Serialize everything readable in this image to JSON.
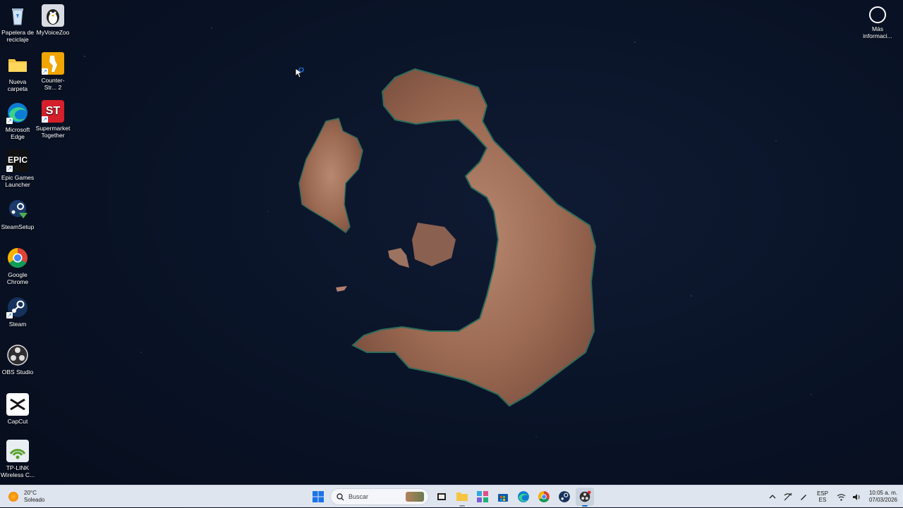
{
  "desktop": {
    "icons": [
      {
        "label": "Papelera de reciclaje",
        "icon": "recycle-bin-icon"
      },
      {
        "label": "MyVoiceZoo",
        "icon": "penguin-app-icon"
      },
      {
        "label": "Nueva carpeta",
        "icon": "folder-icon"
      },
      {
        "label": "Counter-Str... 2",
        "icon": "counter-strike-icon"
      },
      {
        "label": "Microsoft Edge",
        "icon": "edge-icon"
      },
      {
        "label": "Supermarket Together",
        "icon": "supermarket-together-icon"
      },
      {
        "label": "Epic Games Launcher",
        "icon": "epic-games-icon"
      },
      {
        "label": "SteamSetup",
        "icon": "steam-setup-icon"
      },
      {
        "label": "Google Chrome",
        "icon": "chrome-icon"
      },
      {
        "label": "Steam",
        "icon": "steam-icon"
      },
      {
        "label": "OBS Studio",
        "icon": "obs-icon"
      },
      {
        "label": "CapCut",
        "icon": "capcut-icon"
      },
      {
        "label": "TP-LINK Wireless C...",
        "icon": "tplink-wireless-icon"
      }
    ],
    "info_widget_label": "Más informaci...",
    "epic_logo_text": "EPIC",
    "supermarket_logo_text": "ST"
  },
  "taskbar": {
    "weather": {
      "temp": "20°C",
      "condition": "Soleado"
    },
    "search_placeholder": "Buscar",
    "language": {
      "line1": "ESP",
      "line2": "ES"
    },
    "clock": {
      "time": "10:05 a. m.",
      "date": "07/03/2026"
    }
  },
  "colors": {
    "taskbar_bg": "#dfe5ee",
    "accent": "#0b66d0",
    "wallpaper_sea": "#0a1428",
    "island": "#9c6a52"
  }
}
